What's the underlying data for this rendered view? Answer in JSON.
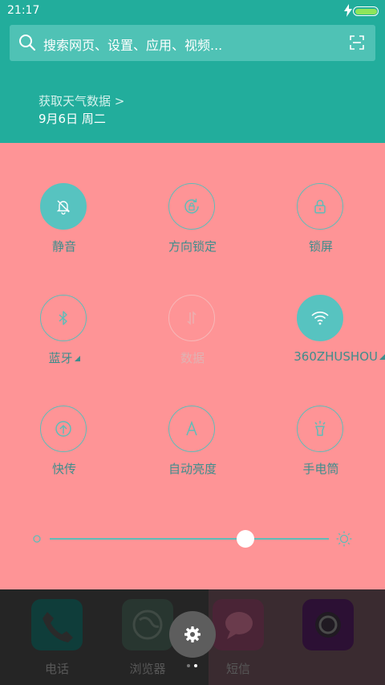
{
  "status_bar": {
    "time": "21:17"
  },
  "search": {
    "placeholder": "搜索网页、设置、应用、视频..."
  },
  "weather": {
    "fetch_label": "获取天气数据 >",
    "date": "9月6日 周二"
  },
  "toggles": [
    {
      "label": "静音",
      "icon": "bell-off-icon",
      "state": "on"
    },
    {
      "label": "方向锁定",
      "icon": "rotation-lock-icon",
      "state": "off"
    },
    {
      "label": "锁屏",
      "icon": "lock-icon",
      "state": "off"
    },
    {
      "label": "蓝牙",
      "icon": "bluetooth-icon",
      "state": "off"
    },
    {
      "label": "数据",
      "icon": "mobile-data-icon",
      "state": "disabled"
    },
    {
      "label": "360ZHUSHOU",
      "icon": "wifi-icon",
      "state": "on"
    },
    {
      "label": "快传",
      "icon": "quick-transfer-icon",
      "state": "off"
    },
    {
      "label": "自动亮度",
      "icon": "auto-brightness-icon",
      "state": "off"
    },
    {
      "label": "手电筒",
      "icon": "flashlight-icon",
      "state": "off"
    }
  ],
  "brightness": {
    "level": 0.7
  },
  "dock": {
    "apps": [
      {
        "label": "电话",
        "icon": "phone-icon"
      },
      {
        "label": "浏览器",
        "icon": "browser-icon"
      },
      {
        "label": "短信",
        "icon": "sms-icon"
      },
      {
        "label": "",
        "icon": "camera-icon"
      }
    ]
  },
  "colors": {
    "header": "#22ad9c",
    "panel": "#fe9496",
    "accent": "#57c3c0"
  }
}
